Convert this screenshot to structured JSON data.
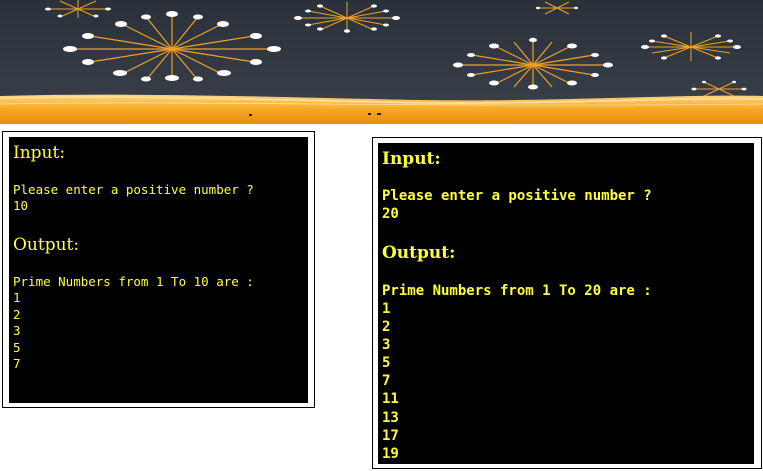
{
  "banner": {
    "background_color": "#2f3640",
    "firework_color": "#f0a020",
    "glow_color": "#f5a623"
  },
  "console_left": {
    "input_heading": "Input:",
    "prompt": "Please enter a positive number ?",
    "entered_value": "10",
    "output_heading": "Output:",
    "result_label": "Prime Numbers from 1 To 10 are :",
    "numbers": [
      "1",
      "2",
      "3",
      "5",
      "7"
    ]
  },
  "console_right": {
    "input_heading": "Input:",
    "prompt": "Please enter a positive number ?",
    "entered_value": "20",
    "output_heading": "Output:",
    "result_label": "Prime Numbers from 1 To 20 are :",
    "numbers": [
      "1",
      "2",
      "3",
      "5",
      "7",
      "11",
      "13",
      "17",
      "19"
    ]
  },
  "colors": {
    "console_background": "#000000",
    "console_text": "#ffff33",
    "frame_border": "#000000"
  }
}
